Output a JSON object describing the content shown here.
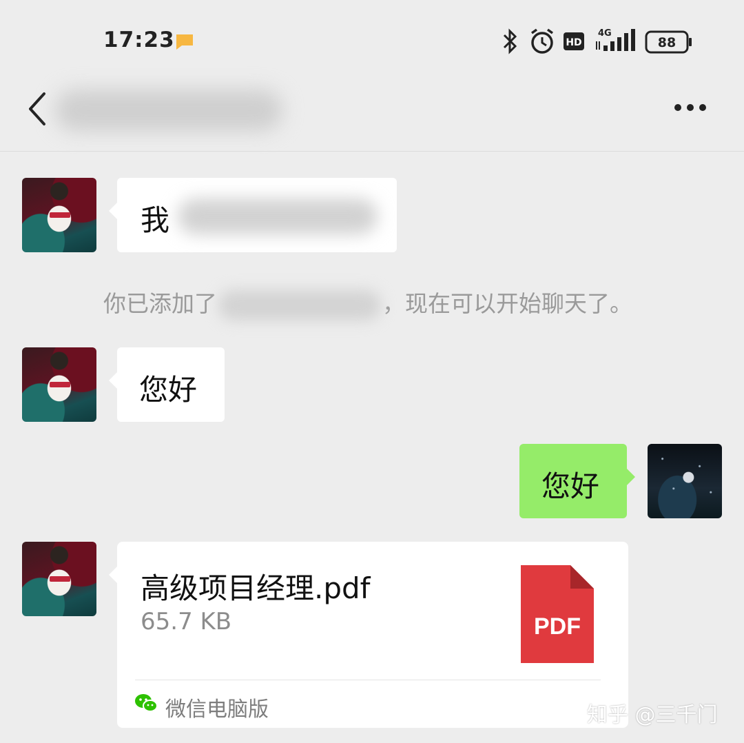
{
  "status_bar": {
    "time": "17:23",
    "network": "4G",
    "hd_label": "HD",
    "battery": "88",
    "icons": [
      "notification-icon",
      "bluetooth-icon",
      "alarm-icon",
      "hd-icon",
      "signal-icon",
      "battery-icon"
    ]
  },
  "header": {
    "back_icon": "chevron-left-icon",
    "more_icon": "more-icon"
  },
  "messages": [
    {
      "from": "contact",
      "text_visible": "我"
    },
    {
      "type": "system",
      "prefix": "你已添加了",
      "suffix": "，现在可以开始聊天了。"
    },
    {
      "from": "contact",
      "text": "您好"
    },
    {
      "from": "me",
      "text": "您好"
    },
    {
      "from": "contact",
      "type": "file",
      "file_name": "高级项目经理.pdf",
      "file_size": "65.7 KB",
      "file_badge": "PDF",
      "source": "微信电脑版"
    }
  ],
  "watermark": "知乎 @三千门",
  "colors": {
    "background": "#ededed",
    "bubble_incoming": "#ffffff",
    "bubble_outgoing": "#95ec69",
    "pdf_red": "#e03a3e",
    "wechat_green": "#2dc100"
  }
}
